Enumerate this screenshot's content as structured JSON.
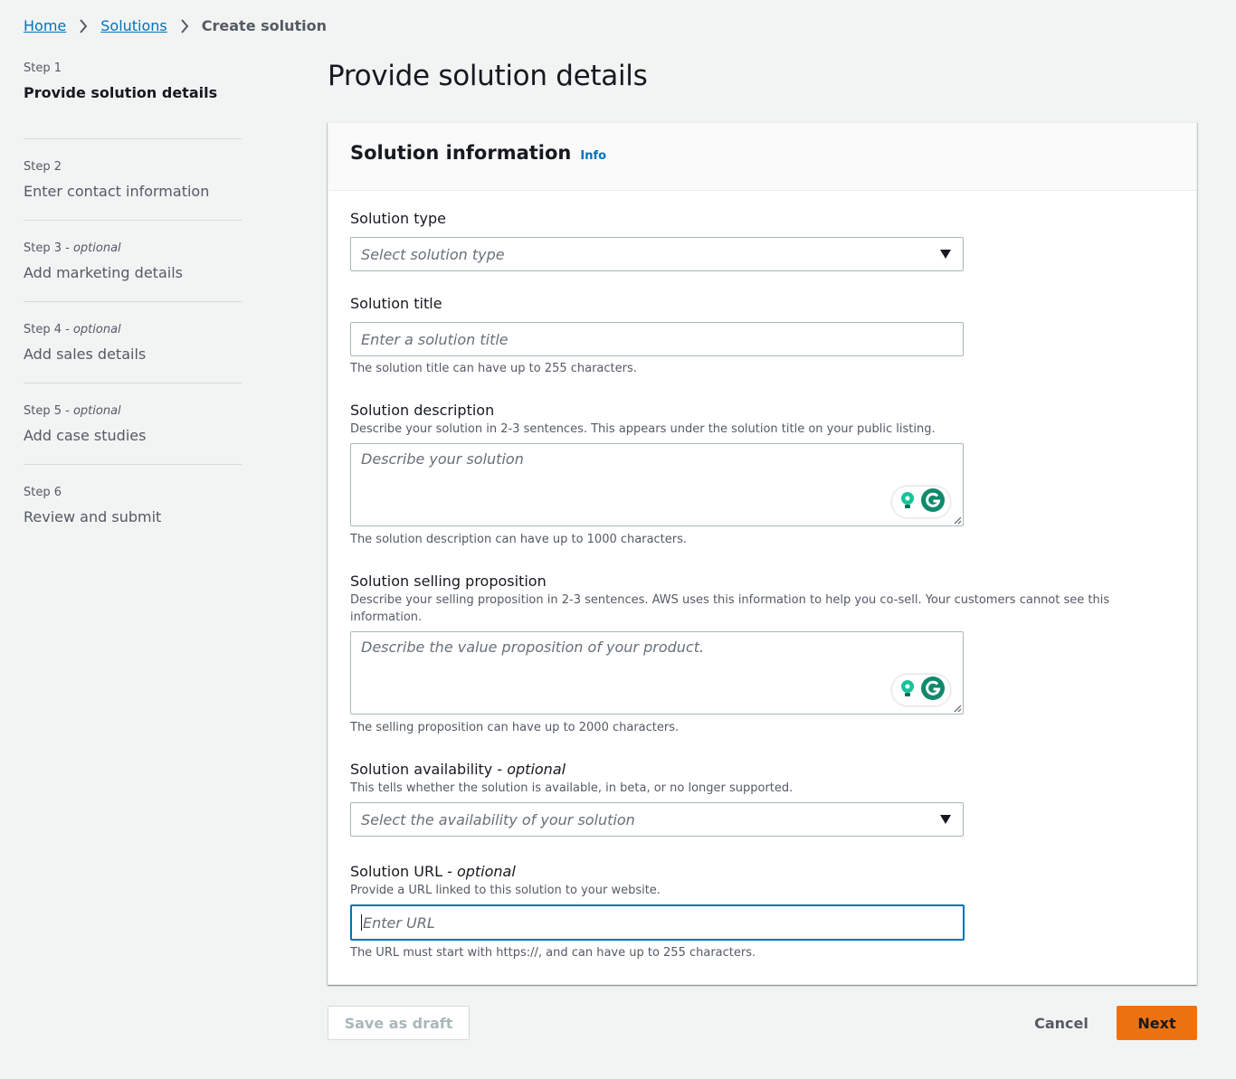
{
  "breadcrumb": {
    "home": "Home",
    "solutions": "Solutions",
    "current": "Create solution"
  },
  "steps": [
    {
      "num": "Step 1",
      "optional": "",
      "label": "Provide solution details",
      "active": true
    },
    {
      "num": "Step 2",
      "optional": "",
      "label": "Enter contact information",
      "active": false
    },
    {
      "num": "Step 3 - ",
      "optional": "optional",
      "label": "Add marketing details",
      "active": false
    },
    {
      "num": "Step 4 - ",
      "optional": "optional",
      "label": "Add sales details",
      "active": false
    },
    {
      "num": "Step 5 - ",
      "optional": "optional",
      "label": "Add case studies",
      "active": false
    },
    {
      "num": "Step 6",
      "optional": "",
      "label": "Review and submit",
      "active": false
    }
  ],
  "page_title": "Provide solution details",
  "panel": {
    "title": "Solution information",
    "info": "Info"
  },
  "fields": {
    "type": {
      "label": "Solution type",
      "placeholder": "Select solution type"
    },
    "title": {
      "label": "Solution title",
      "placeholder": "Enter a solution title",
      "hint": "The solution title can have up to 255 characters."
    },
    "description": {
      "label": "Solution description",
      "desc": "Describe your solution in 2-3 sentences. This appears under the solution title on your public listing.",
      "placeholder": "Describe your solution",
      "hint": "The solution description can have up to 1000 characters."
    },
    "selling": {
      "label": "Solution selling proposition",
      "desc": "Describe your selling proposition in 2-3 sentences. AWS uses this information to help you co-sell. Your customers cannot see this information.",
      "placeholder": "Describe the value proposition of your product.",
      "hint": "The selling proposition can have up to 2000 characters."
    },
    "availability": {
      "label": "Solution availability - ",
      "optional": "optional",
      "desc": "This tells whether the solution is available, in beta, or no longer supported.",
      "placeholder": "Select the availability of your solution"
    },
    "url": {
      "label": "Solution URL - ",
      "optional": "optional",
      "desc": "Provide a URL linked to this solution to your website.",
      "placeholder": "Enter URL",
      "hint": "The URL must start with https://, and can have up to 255 characters."
    }
  },
  "buttons": {
    "save_draft": "Save as draft",
    "cancel": "Cancel",
    "next": "Next"
  },
  "colors": {
    "link": "#0073bb",
    "primary_button": "#ec7211",
    "grammarly_green": "#15c39a"
  },
  "icons": {
    "breadcrumb_separator": "chevron-right-icon",
    "dropdown": "caret-down-icon",
    "grammarly_assist": "lightbulb-icon",
    "grammarly": "grammarly-g-icon"
  }
}
